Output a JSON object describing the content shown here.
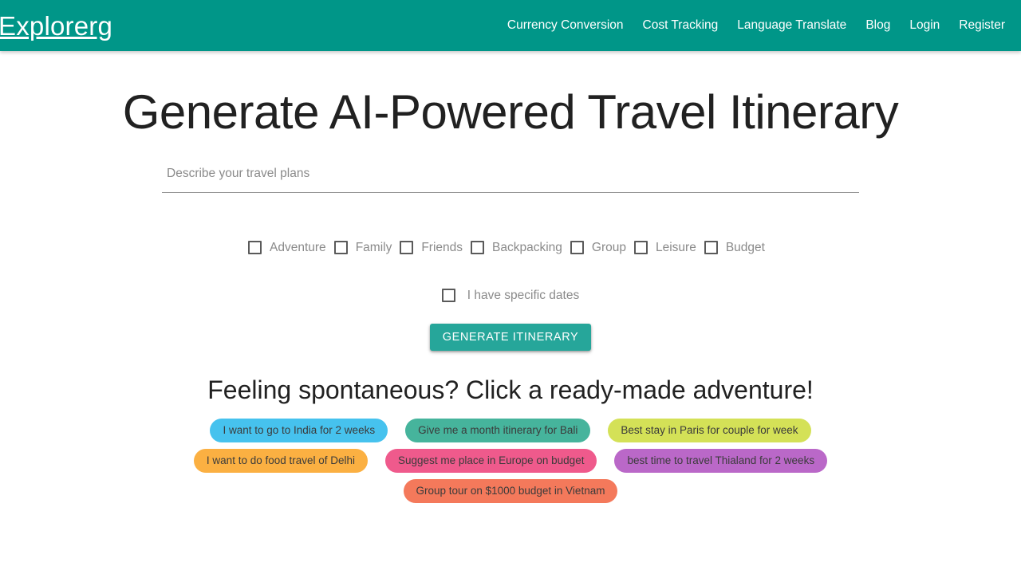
{
  "navbar": {
    "brand": "Explorerg",
    "background_color": "#009688",
    "links": [
      {
        "label": "Currency Conversion",
        "name": "nav-link-currency-conversion"
      },
      {
        "label": "Cost Tracking",
        "name": "nav-link-cost-tracking"
      },
      {
        "label": "Language Translate",
        "name": "nav-link-language-translate"
      },
      {
        "label": "Blog",
        "name": "nav-link-blog"
      },
      {
        "label": "Login",
        "name": "nav-link-login"
      },
      {
        "label": "Register",
        "name": "nav-link-register"
      }
    ]
  },
  "hero": {
    "title": "Generate AI-Powered Travel Itinerary"
  },
  "form": {
    "prompt_input": {
      "placeholder": "Describe your travel plans",
      "value": ""
    },
    "trip_types": [
      {
        "label": "Adventure",
        "checked": false
      },
      {
        "label": "Family",
        "checked": false
      },
      {
        "label": "Friends",
        "checked": false
      },
      {
        "label": "Backpacking",
        "checked": false
      },
      {
        "label": "Group",
        "checked": false
      },
      {
        "label": "Leisure",
        "checked": false
      },
      {
        "label": "Budget",
        "checked": false
      }
    ],
    "specific_dates": {
      "label": "I have specific dates",
      "checked": false
    },
    "submit_label": "GENERATE ITINERARY",
    "submit_color": "#26A69A"
  },
  "suggestions": {
    "heading": "Feeling spontaneous? Click a ready-made adventure!",
    "rows": [
      [
        {
          "label": "I want to go to India for 2 weeks",
          "color": "#46C2EE"
        },
        {
          "label": "Give me a month itinerary for Bali",
          "color": "#46B49C"
        },
        {
          "label": "Best stay in Paris for couple for week",
          "color": "#D4E157"
        }
      ],
      [
        {
          "label": "I want to do food travel of Delhi",
          "color": "#FBB042"
        },
        {
          "label": "Suggest me place in Europe on budget",
          "color": "#EF5A8C"
        },
        {
          "label": "best time to travel Thialand for 2 weeks",
          "color": "#BA68C8"
        }
      ],
      [
        {
          "label": "Group tour on $1000 budget in Vietnam",
          "color": "#F4795B"
        }
      ]
    ]
  }
}
